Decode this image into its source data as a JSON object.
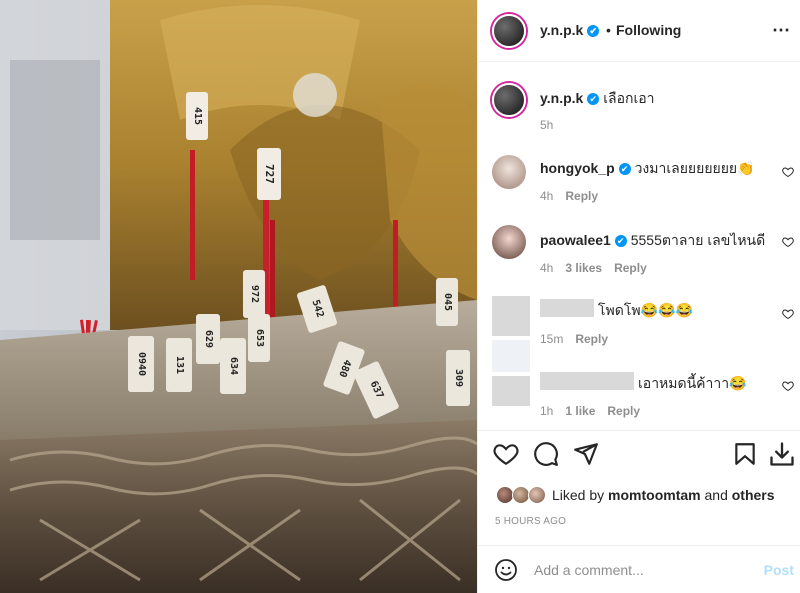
{
  "post_author": {
    "username": "y.n.p.k",
    "verified_badge": "✔",
    "separator": "•",
    "follow_status": "Following",
    "more_icon": "⋯"
  },
  "caption": {
    "username": "y.n.p.k",
    "text": "เลือกเอา",
    "time": "5h"
  },
  "comments": [
    {
      "username": "hongyok_p",
      "verified": true,
      "text": "วงมาเลยยยยยยย👏",
      "time": "4h",
      "likes": "",
      "reply": "Reply"
    },
    {
      "username": "paowalee1",
      "verified": true,
      "text": "5555ตาลาย เลขไหนดี",
      "time": "4h",
      "likes": "3 likes",
      "reply": "Reply"
    },
    {
      "username": "",
      "verified": false,
      "text": "โพดโพ😂😂😂",
      "time": "15m",
      "likes": "",
      "reply": "Reply"
    },
    {
      "username": "",
      "verified": false,
      "text": "เอาหมดนี้ค้าาา😂",
      "time": "1h",
      "likes": "1 like",
      "reply": "Reply"
    }
  ],
  "actions": {
    "like_icon": "heart-icon",
    "comment_icon": "comment-icon",
    "share_icon": "share-icon",
    "save_icon": "bookmark-icon",
    "download_icon": "download-icon"
  },
  "likes": {
    "prefix": "Liked by",
    "user": "momtoomtam",
    "connector": "and",
    "suffix": "others"
  },
  "post_time": "5 HOURS AGO",
  "add_comment": {
    "placeholder": "Add a comment...",
    "post_label": "Post",
    "emoji_icon": "smiley-icon"
  },
  "photo": {
    "stick_labels": [
      "415",
      "727",
      "972",
      "542",
      "045",
      "0940",
      "131",
      "634",
      "629",
      "653",
      "309",
      "480",
      "637"
    ]
  },
  "colors": {
    "accent": "#0095f6",
    "post_disabled": "#b2dffc",
    "muted": "#8e8e8e",
    "text": "#262626"
  }
}
